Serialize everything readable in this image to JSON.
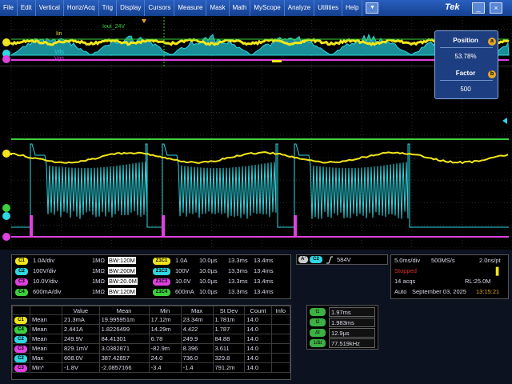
{
  "menu": {
    "items": [
      "File",
      "Edit",
      "Vertical",
      "Horiz/Acq",
      "Trig",
      "Display",
      "Cursors",
      "Measure",
      "Mask",
      "Math",
      "MyScope",
      "Analyze",
      "Utilities",
      "Help"
    ],
    "brand": "Tek"
  },
  "zoom_labels": {
    "iin": "Iin",
    "iout": "Iout_24V",
    "vds": "Vds",
    "vgs": "Vgs"
  },
  "position_box": {
    "position_label": "Position",
    "position_value": "53.78%",
    "factor_label": "Factor",
    "factor_value": "500",
    "knob_a": "a",
    "knob_b": "b"
  },
  "channels": [
    {
      "badge": "C1",
      "color": "#f2e61a",
      "scale": "1.0A/div",
      "imp": "1MΩ",
      "bw": "BW:120M"
    },
    {
      "badge": "C2",
      "color": "#2fd6e0",
      "scale": "100V/div",
      "imp": "1MΩ",
      "bw": "BW:200M"
    },
    {
      "badge": "C3",
      "color": "#e040e0",
      "scale": "10.0V/div",
      "imp": "1MΩ",
      "bw": "BW:20.0M"
    },
    {
      "badge": "C4",
      "color": "#3cd03c",
      "scale": "600mA/div",
      "imp": "1MΩ",
      "bw": "BW:120M"
    }
  ],
  "zoom_channels": [
    {
      "badge": "Z1C1",
      "color": "#f2e61a",
      "scale": "1.0A",
      "t1": "10.0µs",
      "t2": "13.3ms",
      "t3": "13.4ms"
    },
    {
      "badge": "Z1C2",
      "color": "#2fd6e0",
      "scale": "100V",
      "t1": "10.0µs",
      "t2": "13.3ms",
      "t3": "13.4ms"
    },
    {
      "badge": "Z1C3",
      "color": "#e040e0",
      "scale": "10.0V",
      "t1": "10.0µs",
      "t2": "13.3ms",
      "t3": "13.4ms"
    },
    {
      "badge": "Z1C4",
      "color": "#3cd03c",
      "scale": "600mA",
      "t1": "10.0µs",
      "t2": "13.3ms",
      "t3": "13.4ms"
    }
  ],
  "trigger": {
    "badge": "A'",
    "channel": "C2",
    "level": "584V"
  },
  "timebase": {
    "scale": "5.0ms/div",
    "rate": "500MS/s",
    "res": "2.0ns/pt",
    "state": "Stopped",
    "acqs": "14 acqs",
    "rl": "RL:25.0M",
    "mode": "Auto",
    "date": "September 03, 2025",
    "time": "13:15:21"
  },
  "measurements": {
    "headers": [
      "",
      "",
      "Value",
      "Mean",
      "Min",
      "Max",
      "St Dev",
      "Count",
      "Info"
    ],
    "rows": [
      {
        "ch": "C1",
        "color": "#f2e61a",
        "type": "Mean",
        "value": "21.3mA",
        "mean": "19.995951m",
        "min": "17.12m",
        "max": "23.34m",
        "stdev": "1.781m",
        "count": "14.0"
      },
      {
        "ch": "C4",
        "color": "#3cd03c",
        "type": "Mean",
        "value": "2.441A",
        "mean": "1.8226499",
        "min": "14.29m",
        "max": "4.422",
        "stdev": "1.787",
        "count": "14.0"
      },
      {
        "ch": "C2",
        "color": "#2fd6e0",
        "type": "Mean",
        "value": "249.9V",
        "mean": "84.41301",
        "min": "6.78",
        "max": "249.9",
        "stdev": "84.88",
        "count": "14.0"
      },
      {
        "ch": "C3",
        "color": "#e040e0",
        "type": "Mean",
        "value": "829.1mV",
        "mean": "3.0382871",
        "min": "-82.9m",
        "max": "8.396",
        "stdev": "3.611",
        "count": "14.0"
      },
      {
        "ch": "C2",
        "color": "#2fd6e0",
        "type": "Max",
        "value": "608.0V",
        "mean": "387.42857",
        "min": "24.0",
        "max": "736.0",
        "stdev": "329.8",
        "count": "14.0"
      },
      {
        "ch": "C3",
        "color": "#e040e0",
        "type": "Min*",
        "value": "-1.8V",
        "mean": "-2.0857166",
        "min": "-3.4",
        "max": "-1.4",
        "stdev": "791.2m",
        "count": "14.0"
      }
    ]
  },
  "cursors": [
    {
      "label": "t1",
      "value": "1.97ms"
    },
    {
      "label": "t2",
      "value": "1.983ms"
    },
    {
      "label": "Δt",
      "value": "12.9µs"
    },
    {
      "label": "1/Δt",
      "value": "77.519kHz"
    }
  ],
  "window_buttons": {
    "minimize": "_",
    "close": "×"
  },
  "dropdown_glyph": "▼"
}
